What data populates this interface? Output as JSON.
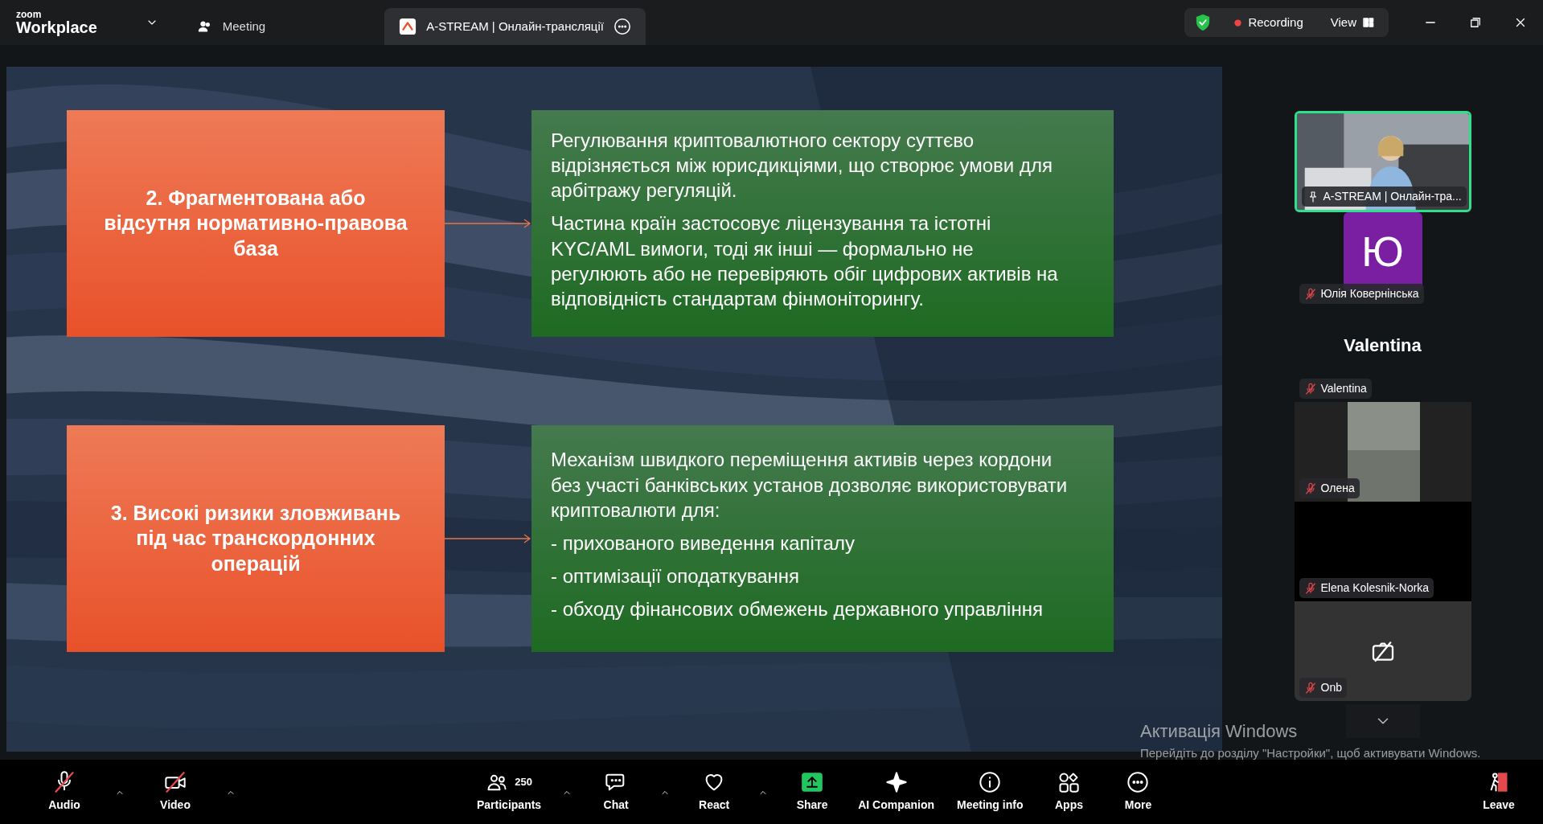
{
  "app": {
    "logo_top": "zoom",
    "logo_bottom": "Workplace"
  },
  "tabs": [
    {
      "label": "Meeting",
      "selected": false
    },
    {
      "label": "A-STREAM | Онлайн-трансляції",
      "selected": true
    }
  ],
  "status": {
    "recording": "Recording",
    "view": "View"
  },
  "slide": {
    "rows": [
      {
        "title": "2. Фрагментована або відсутня нормативно-правова база",
        "paragraphs": [
          "Регулювання криптовалютного сектору суттєво відрізняється між юрисдикціями, що створює умови для арбітражу регуляцій.",
          "Частина країн застосовує ліцензування та істотні KYC/AML вимоги, тоді як інші — формально не регулюють або не перевіряють обіг цифрових активів на відповідність стандартам фінмоніторингу."
        ]
      },
      {
        "title": "3. Високі ризики зловживань під час транскордонних операцій",
        "paragraphs": [
          "Механізм швидкого переміщення активів через кордони без участі банківських установ дозволяє використовувати криптовалюти для:",
          "- прихованого виведення капіталу",
          "- оптимізації оподаткування",
          "- обходу фінансових обмежень державного управління"
        ]
      }
    ]
  },
  "participants": [
    {
      "kind": "video",
      "name": "A-STREAM | Онлайн-тра...",
      "muted": false,
      "speaking": true
    },
    {
      "kind": "avatar",
      "initial": "Ю",
      "color": "#7b1fa2",
      "name": "Юлія Ковернінська",
      "muted": true,
      "speaking": false
    },
    {
      "kind": "name",
      "display": "Valentina",
      "name": "Valentina",
      "muted": true,
      "speaking": false
    },
    {
      "kind": "video",
      "name": "Олена",
      "muted": true,
      "speaking": false
    },
    {
      "kind": "blank",
      "name": "Elena Kolesnik-Norka",
      "muted": true,
      "speaking": false
    },
    {
      "kind": "camera_off",
      "name": "Onb",
      "muted": true,
      "speaking": false
    }
  ],
  "toolbar": {
    "left": [
      {
        "kind": "audio",
        "label": "Audio"
      },
      {
        "kind": "video",
        "label": "Video"
      }
    ],
    "center": [
      {
        "kind": "participants",
        "label": "Participants",
        "count": "250"
      },
      {
        "kind": "chat",
        "label": "Chat"
      },
      {
        "kind": "react",
        "label": "React"
      },
      {
        "kind": "share",
        "label": "Share"
      },
      {
        "kind": "ai",
        "label": "AI Companion"
      },
      {
        "kind": "info",
        "label": "Meeting info"
      },
      {
        "kind": "apps",
        "label": "Apps"
      },
      {
        "kind": "more",
        "label": "More"
      }
    ],
    "right": [
      {
        "kind": "leave",
        "label": "Leave"
      }
    ]
  },
  "windows_notice": {
    "title": "Активація Windows",
    "text": "Перейдіть до розділу \"Настройки\", щоб активувати Windows."
  }
}
